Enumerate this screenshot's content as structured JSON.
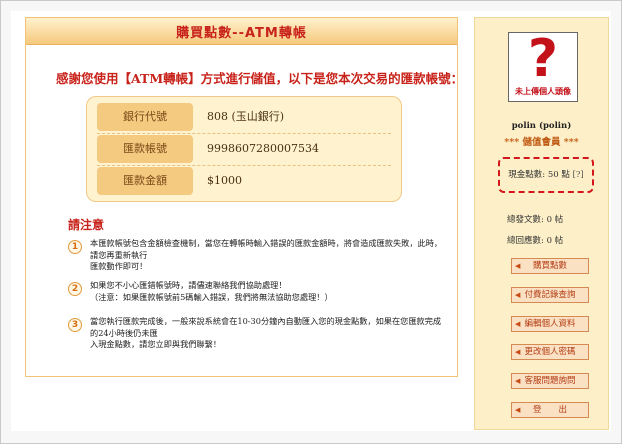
{
  "header": {
    "title": "購買點數--ATM轉帳"
  },
  "intro": {
    "text": "感謝您使用【ATM轉帳】方式進行儲值，以下是您本次交易的匯款帳號："
  },
  "account": {
    "rows": [
      {
        "label": "銀行代號",
        "value": "808 (玉山銀行)"
      },
      {
        "label": "匯款帳號",
        "value": "9998607280007534"
      },
      {
        "label": "匯款金額",
        "value": "$1000"
      }
    ]
  },
  "notes": {
    "title": "請注意",
    "items": [
      {
        "num": "1",
        "text": "本匯款帳號包含金額檢查機制，當您在轉帳時輸入錯誤的匯款金額時，將會造成匯款失敗，此時，\n請您再重新執行\n匯款動作即可！"
      },
      {
        "num": "2",
        "text": "如果您不小心匯錯帳號時，請儘速聯絡我們協助處理！\n（注意：如果匯款帳號前5碼輸入錯誤，我們將無法協助您處理！）"
      },
      {
        "num": "3",
        "text": "當您執行匯款完成後，一般來說系統會在10-30分鐘內自動匯入您的現金點數，如果在您匯款完成\n的24小時後仍未匯\n入現金點數，請您立即與我們聯繫！"
      }
    ]
  },
  "sidebar": {
    "avatar_caption": "未上傳個人頭像",
    "username": "polin (polin)",
    "level": "*** 儲值會員 ***",
    "points_label": "現金點數: 50 點",
    "points_help": "[?]",
    "stats": [
      {
        "text": "總發文數: 0 帖"
      },
      {
        "text": "總回應數: 0 帖"
      }
    ],
    "buttons": [
      {
        "label": "購買點數"
      },
      {
        "label": "付費記錄查詢"
      },
      {
        "label": "編輯個人資料"
      },
      {
        "label": "更改個人密碼"
      },
      {
        "label": "客服問題詢問"
      },
      {
        "label": "登　　出"
      }
    ]
  },
  "colors": {
    "accent_red": "#c8231b",
    "panel_orange": "#f4c980",
    "sidebar_bg": "#fdf0c8",
    "highlight_dash": "#d3161c"
  },
  "icons": {
    "avatar_placeholder": "question-mark-icon",
    "note_number": "circled-number-icon",
    "button_arrow": "arrow-right-icon"
  }
}
